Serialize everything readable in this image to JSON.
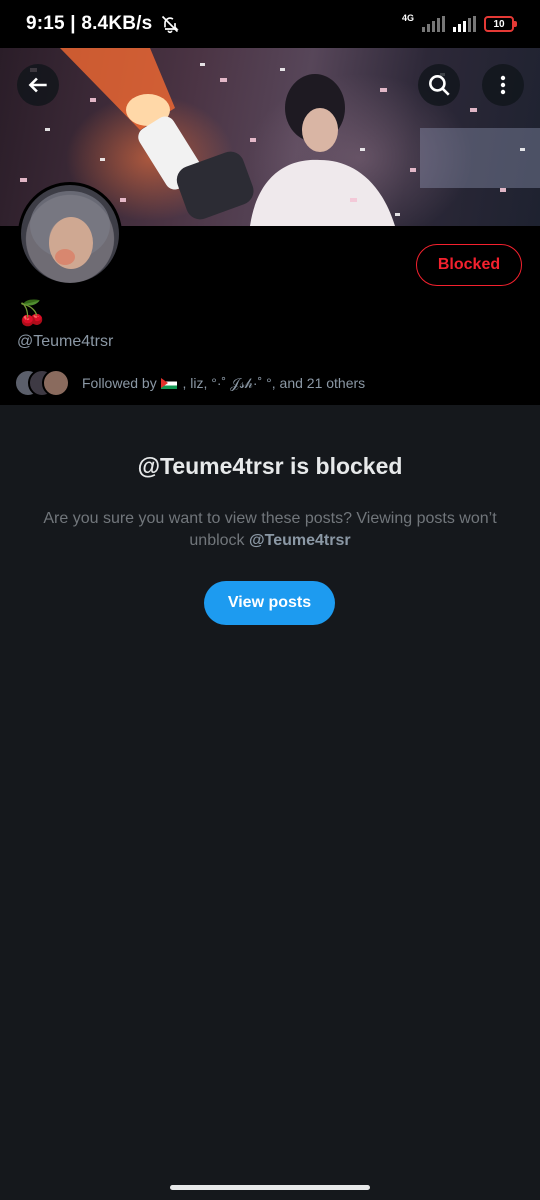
{
  "status_bar": {
    "time": "9:15",
    "network_speed": "8.4KB/s",
    "network_type": "4G",
    "battery": "10",
    "icons": [
      "bell-off-icon",
      "signal-icon",
      "signal-icon",
      "battery-icon"
    ]
  },
  "header": {
    "back_icon": "arrow-left-icon",
    "search_icon": "search-icon",
    "more_icon": "more-vertical-icon"
  },
  "profile": {
    "display_name": "🍒",
    "handle": "@Teume4trsr",
    "blocked_label": "Blocked",
    "followed_prefix": "Followed by",
    "followed_names": " , liz, °·˚ 𝒥𝓈𝒽·˚ °, and 21 others"
  },
  "blocked": {
    "title": "@Teume4trsr is blocked",
    "description": "Are you sure you want to view these posts? Viewing posts won’t unblock",
    "description_handle": "@Teume4trsr",
    "view_label": "View posts"
  },
  "colors": {
    "accent": "#1d9bf0",
    "blocked_red": "#f4212e",
    "background": "#15181c",
    "secondary_text": "#71767b"
  }
}
